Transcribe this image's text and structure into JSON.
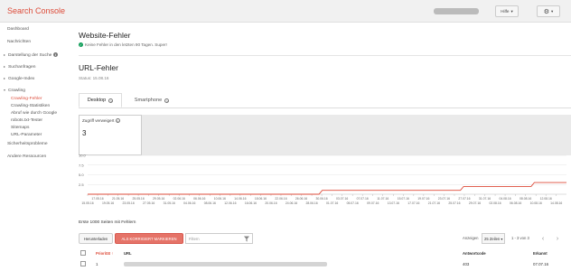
{
  "app": {
    "title": "Search Console"
  },
  "header": {
    "settings_label": "⚙",
    "language_label": "Hilfe",
    "dropdown_caret": "▾"
  },
  "sidebar": {
    "items": [
      {
        "label": "Dashboard"
      },
      {
        "label": "Nachrichten"
      },
      {
        "label": "Darstellung der Suche"
      },
      {
        "label": "Suchanfragen"
      },
      {
        "label": "Google-Index"
      },
      {
        "label": "Crawling"
      },
      {
        "label": "Crawling-Fehler"
      },
      {
        "label": "Crawling-Statistiken"
      },
      {
        "label": "Abruf wie durch Google"
      },
      {
        "label": "robots.txt-Tester"
      },
      {
        "label": "Sitemaps"
      },
      {
        "label": "URL-Parameter"
      },
      {
        "label": "Sicherheitsprobleme"
      },
      {
        "label": "Andere Ressourcen"
      }
    ]
  },
  "site_errors": {
    "title": "Website-Fehler",
    "status": "Keine Fehler in den letzten 90 Tagen. Super!"
  },
  "url_errors": {
    "title": "URL-Fehler",
    "status": "Status: 15.08.16"
  },
  "tabs": [
    {
      "label": "Desktop"
    },
    {
      "label": "Smartphone"
    }
  ],
  "metric": {
    "label": "Zugriff verweigert",
    "value": "3"
  },
  "chart_data": {
    "type": "line",
    "y_ticks": [
      "10.0",
      "7.5",
      "5.0",
      "2.5"
    ],
    "ylim": [
      0,
      10
    ],
    "x_ticks_top": [
      "17.05.16",
      "21.05.16",
      "25.05.16",
      "29.05.16",
      "02.06.16",
      "06.06.16",
      "10.06.16",
      "14.06.16",
      "18.06.16",
      "22.06.16",
      "26.06.16",
      "30.06.16",
      "03.07.16",
      "07.07.16",
      "11.07.16",
      "15.07.16",
      "19.07.16",
      "23.07.16",
      "27.07.16",
      "31.07.16",
      "04.08.16",
      "08.08.16",
      "12.08.16"
    ],
    "x_ticks_bottom": [
      "15.05.16",
      "19.05.16",
      "23.05.16",
      "27.05.16",
      "31.05.16",
      "04.06.16",
      "08.06.16",
      "12.06.16",
      "16.06.16",
      "20.06.16",
      "24.06.16",
      "28.06.16",
      "01.07.16",
      "05.07.16",
      "09.07.16",
      "13.07.16",
      "17.07.16",
      "21.07.16",
      "25.07.16",
      "29.07.16",
      "02.08.16",
      "06.08.16",
      "10.08.16",
      "14.08.16"
    ],
    "series": [
      {
        "values": [
          0,
          0,
          0,
          0,
          0,
          0,
          0,
          0,
          0,
          0,
          0,
          0,
          0,
          0,
          0,
          0,
          0,
          0,
          0,
          0,
          0,
          0,
          0,
          0,
          0,
          0,
          0,
          0,
          0,
          0,
          0,
          0,
          0,
          0,
          0,
          0,
          0,
          0,
          0,
          0,
          0,
          0,
          0,
          0,
          0,
          0,
          0,
          0,
          0,
          0,
          0,
          0,
          0,
          0,
          0,
          0,
          0,
          0,
          0,
          0,
          0,
          0,
          0,
          0,
          0,
          0,
          0,
          0,
          0,
          0,
          0,
          0,
          0,
          1,
          1,
          1,
          1,
          1,
          1,
          1,
          1,
          1,
          1,
          1,
          1,
          1,
          1,
          1,
          1,
          1,
          1,
          1,
          1,
          1,
          1,
          1,
          1,
          1,
          1,
          1,
          1,
          1,
          1,
          1,
          1,
          1,
          1,
          1,
          1,
          1,
          1,
          1,
          1,
          1,
          1,
          1,
          1,
          2,
          2,
          2,
          2,
          2,
          2,
          2,
          2,
          2,
          2,
          2,
          2,
          2,
          2,
          2,
          2,
          2,
          2,
          2,
          2,
          2,
          2,
          3,
          3,
          3,
          3,
          3,
          3,
          3,
          3,
          3,
          3,
          3
        ],
        "color": "#dd4b39"
      }
    ]
  },
  "table_section": {
    "title": "Erste 1000 Seiten mit Fehlern",
    "mark_fixed": "Herunterladen",
    "mark_resolved": "ALS KORRIGIERT MARKIEREN",
    "filter_placeholder": "Filtern",
    "show_label": "Anzeigen",
    "rows_per_page": "25 Zeilen ▾",
    "range": "1 - 3 von 3",
    "columns": [
      "Priorität ↑",
      "URL",
      "Antwortcode",
      "Erkannt"
    ],
    "rows": [
      {
        "priority": "1",
        "code": "403",
        "detected": "07.07.16"
      }
    ]
  }
}
